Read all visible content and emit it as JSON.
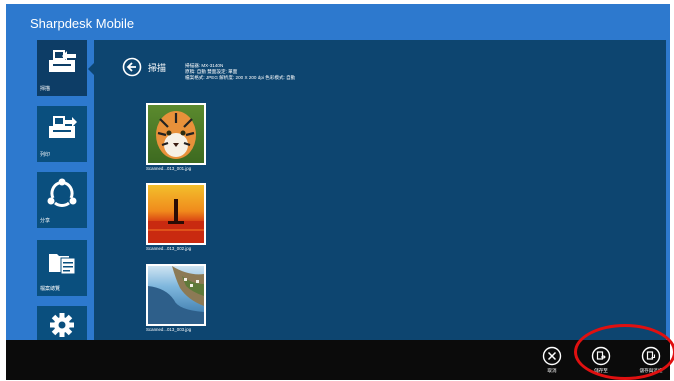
{
  "app": {
    "title": "Sharpdesk Mobile"
  },
  "sidebar": {
    "items": [
      {
        "label": "掃描",
        "icon": "scan-icon",
        "active": true
      },
      {
        "label": "列印",
        "icon": "print-icon",
        "active": false
      },
      {
        "label": "分享",
        "icon": "share-icon",
        "active": false
      },
      {
        "label": "檔案總覽",
        "icon": "file-manager-icon",
        "active": false
      },
      {
        "label": "",
        "icon": "settings-gear-icon",
        "active": false
      }
    ]
  },
  "main": {
    "title": "掃描",
    "info": [
      "掃描器: MX-3140N",
      "原稿: 自動   雙面設定: 單面",
      "檔案格式: JPEG   解析度: 200 X 200 dpi   色彩模式: 自動"
    ],
    "thumbnails": [
      {
        "caption": "Scanned...013_001.jpg"
      },
      {
        "caption": "Scanned...013_002.jpg"
      },
      {
        "caption": "Scanned...013_003.jpg"
      }
    ]
  },
  "appbar": {
    "buttons": [
      {
        "label": "取消",
        "icon": "cancel-icon"
      },
      {
        "label": "儲存至",
        "icon": "save-to-icon"
      },
      {
        "label": "儲存與這裡",
        "icon": "save-here-icon"
      }
    ]
  },
  "colors": {
    "blue_bg": "#2d79ce",
    "panel": "#0d4570",
    "tile": "#0a4f7e",
    "appbar": "#0b0b0b",
    "highlight": "#e01010"
  }
}
